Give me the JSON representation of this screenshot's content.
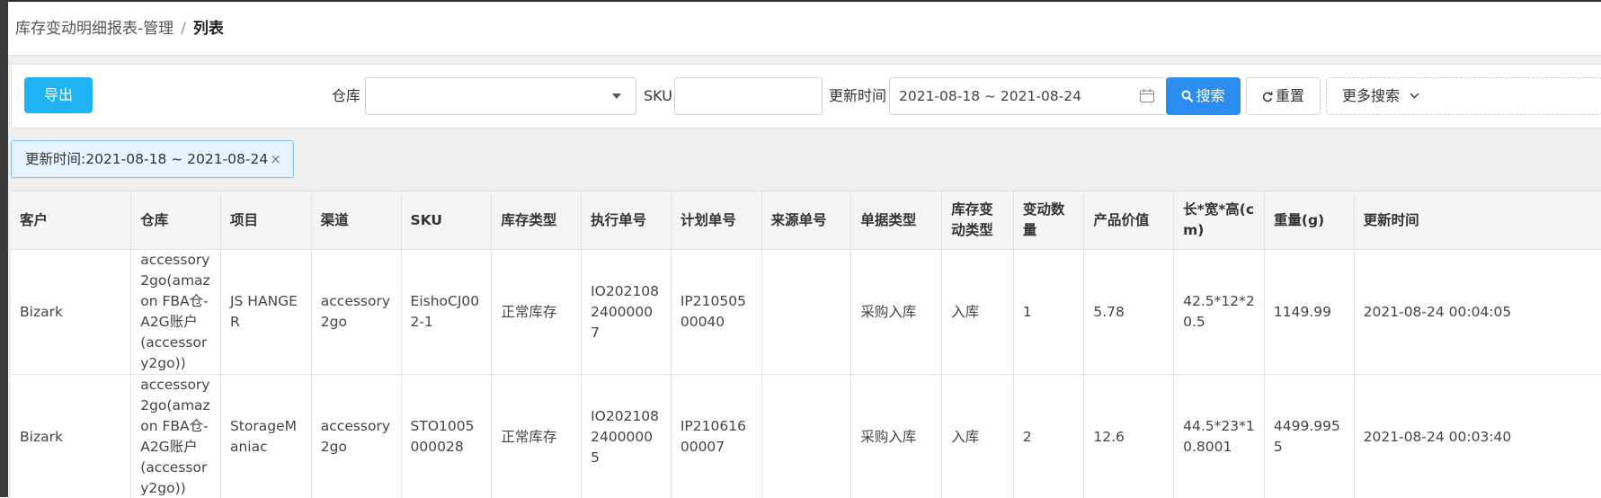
{
  "breadcrumb": {
    "parent": "库存变动明细报表-管理",
    "separator": "/",
    "current": "列表"
  },
  "toolbar": {
    "export_label": "导出",
    "warehouse_label": "仓库",
    "warehouse_value": "",
    "sku_label": "SKU",
    "sku_value": "",
    "update_time_label": "更新时间",
    "update_time_value": "2021-08-18 ~ 2021-08-24",
    "search_label": "搜索",
    "reset_label": "重置",
    "more_label": "更多搜索"
  },
  "filter_tag": {
    "text": "更新时间:2021-08-18 ~ 2021-08-24",
    "close": "×"
  },
  "table": {
    "headers": [
      "客户",
      "仓库",
      "项目",
      "渠道",
      "SKU",
      "库存类型",
      "执行单号",
      "计划单号",
      "来源单号",
      "单据类型",
      "库存变动类型",
      "变动数量",
      "产品价值",
      "长*宽*高(cm)",
      "重量(g)",
      "更新时间"
    ],
    "rows": [
      [
        "Bizark",
        "accessory2go(amazon FBA仓-A2G账户(accessory2go))",
        "JS HANGER",
        "accessory2go",
        "EishoCJ002-1",
        "正常库存",
        "IO20210824000007",
        "IP21050500040",
        "",
        "采购入库",
        "入库",
        "1",
        "5.78",
        "42.5*12*20.5",
        "1149.99",
        "2021-08-24 00:04:05"
      ],
      [
        "Bizark",
        "accessory2go(amazon FBA仓-A2G账户(accessory2go))",
        "StorageManiac",
        "accessory2go",
        "STO1005000028",
        "正常库存",
        "IO20210824000005",
        "IP21061600007",
        "",
        "采购入库",
        "入库",
        "2",
        "12.6",
        "44.5*23*10.8001",
        "4499.9955",
        "2021-08-24 00:03:40"
      ]
    ]
  },
  "colors": {
    "export": "#1fb2f5",
    "search": "#2d8cf0",
    "tag_bg": "#e8f4fd",
    "tag_border": "#7fc1f2"
  },
  "icons": {
    "search": "search-icon",
    "reset": "refresh-icon",
    "more": "chevron-down-icon",
    "calendar": "calendar-icon",
    "caret": "caret-down-icon",
    "close": "close-icon"
  }
}
